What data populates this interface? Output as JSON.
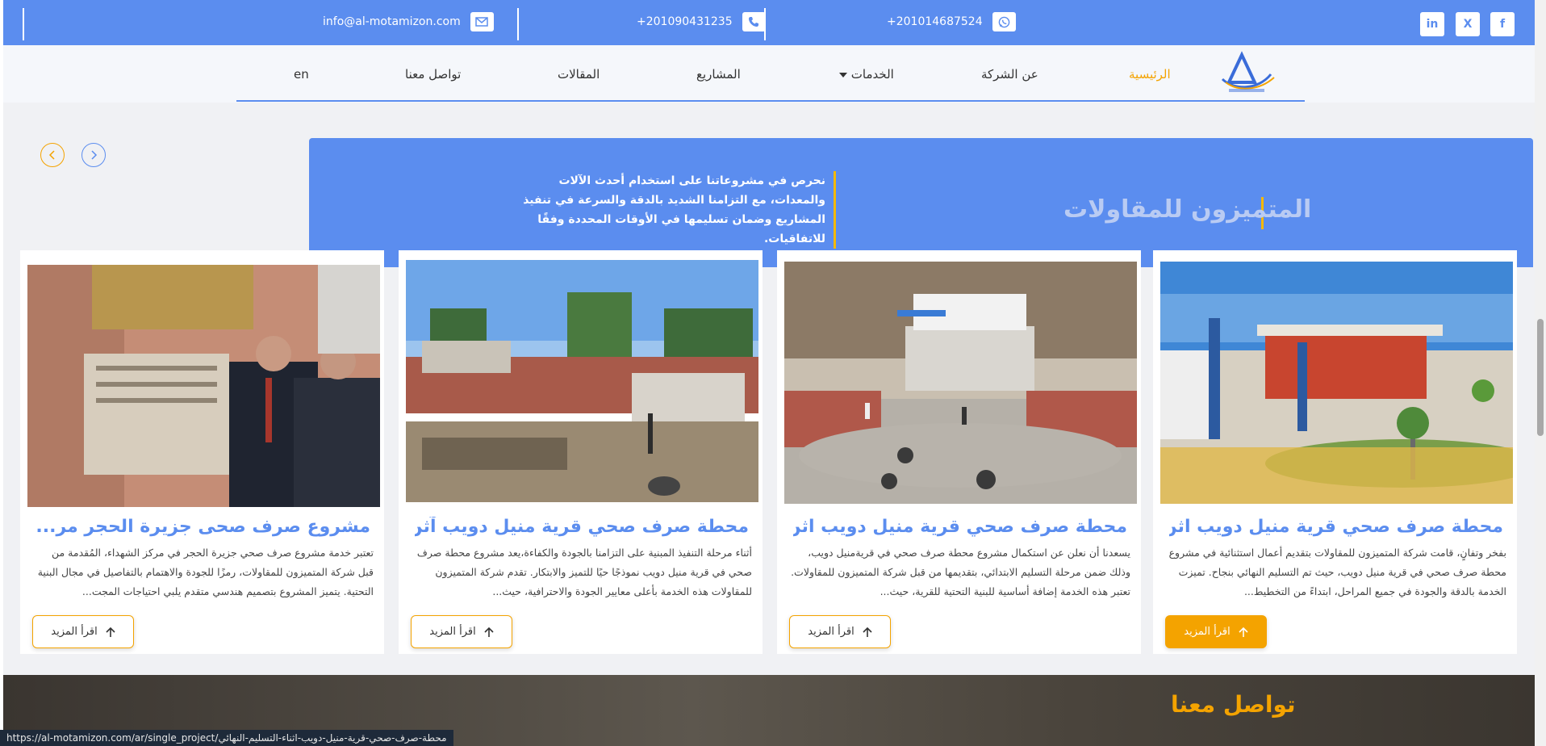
{
  "topbar": {
    "email": "info@al-motamizon.com",
    "phone1": "+201090431235",
    "phone2": "+201014687524",
    "social": [
      "in",
      "X",
      "f"
    ],
    "icons": [
      "mail-icon",
      "phone-icon",
      "whatsapp-icon",
      "linkedin-icon",
      "x-icon",
      "facebook-icon"
    ]
  },
  "nav": {
    "items": [
      {
        "label": "الرئيسية",
        "active": true
      },
      {
        "label": "عن الشركة"
      },
      {
        "label": "الخدمات",
        "dropdown": true
      },
      {
        "label": "المشاريع"
      },
      {
        "label": "المقالات"
      },
      {
        "label": "تواصل معنا"
      },
      {
        "label": "en"
      }
    ]
  },
  "banner": {
    "brand": "المتميزون للمقاولات",
    "quote": "نحرص في مشروعاتنا على استخدام أحدث الآلات والمعدات، مع التزامنا الشديد بالدقة والسرعة في تنفيذ المشاريع وضمان تسليمها في الأوقات المحددة وفقًا للاتفاقيات."
  },
  "cards": [
    {
      "title": "محطة صرف صحي قرية منيل دويب اثن...",
      "desc": "بفخر وتفانٍ، قامت شركة المتميزون للمقاولات بتقديم أعمال استثنائية في مشروع محطة صرف صحي في قرية منيل دويب، حيث تم التسليم النهائي بنجاح. تميزت الخدمة بالدقة والجودة في جميع المراحل، ابتداءً من التخطيط...",
      "button": "اقرأ المزيد",
      "filled": true
    },
    {
      "title": "محطة صرف صحي قرية منيل دويب اثن...",
      "desc": "يسعدنا أن نعلن عن استكمال مشروع محطة صرف صحي في قريةمنيل دويب، وذلك ضمن مرحلة التسليم الابتدائي، بتقديمها من قبل شركة المتميزون للمقاولات. تعتبر هذه الخدمة إضافة أساسية للبنية التحتية للقرية، حيث...",
      "button": "اقرأ المزيد",
      "filled": false
    },
    {
      "title": "محطة صرف صحي قرية منيل دويب آثن...",
      "desc": "أثناء مرحلة التنفيذ المبنية على التزامنا بالجودة والكفاءة،يعد مشروع محطة صرف صحي في قرية منيل دويب نموذجًا حيًا للتميز والابتكار. تقدم شركة المتميزون للمقاولات هذه الخدمة بأعلى معايير الجودة والاحترافية، حيث...",
      "button": "اقرأ المزيد",
      "filled": false
    },
    {
      "title": "مشروع صرف صحى جزيرة الحجر مر...",
      "desc": "تعتبر خدمة مشروع صرف صحي جزيرة الحجر في مركز الشهداء، المُقدمة من قبل شركة المتميزون للمقاولات، رمزًا للجودة والاهتمام بالتفاصيل في مجال البنية التحتية. يتميز المشروع بتصميم هندسي متقدم يلبي احتياجات المجت...",
      "button": "اقرأ المزيد",
      "filled": false
    }
  ],
  "contact_section": {
    "title": "تواصل معنا"
  },
  "status_url": "https://al-motamizon.com/ar/single_project/محطة-صرف-صحي-قرية-منيل-دويب-اثناء-التسليم-النهائي",
  "colors": {
    "primary": "#5b8def",
    "accent": "#f4a300"
  }
}
